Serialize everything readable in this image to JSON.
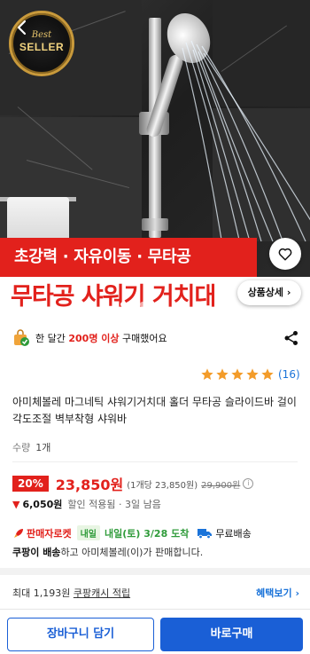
{
  "hero": {
    "badge_top": "Best",
    "badge_main": "SELLER",
    "headline_top": "초강력 · 자유이동 · 무타공",
    "headline_main": "무타공 샤워기 거치대",
    "detail_button": "상품상세",
    "slide_count": 5,
    "active_slide": 1,
    "colors": {
      "band_red": "#e2211c"
    }
  },
  "purchase_stats": {
    "prefix": "한 달간",
    "count": "200명 이상",
    "suffix": "구매했어요"
  },
  "rating": {
    "stars": 5,
    "count": "(16)"
  },
  "product": {
    "title": "아미체볼레 마그네틱 샤워기거치대 홀더 무타공 슬라이드바 걸이 각도조절 벽부착형 샤워바",
    "quantity_label": "수량",
    "quantity_value": "1개"
  },
  "price": {
    "discount": "20%",
    "sale": "23,850원",
    "unit_price": "(1개당 23,850원)",
    "original": "29,900원",
    "info_glyph": "i",
    "savings_amount": "6,050원",
    "savings_note": "할인 적용됨 · 3일 남음",
    "colors": {
      "sale": "#e2211c",
      "link": "#1a73d9",
      "primary": "#1a5fd6"
    }
  },
  "delivery": {
    "rocket_label": "판매자로켓",
    "tomorrow_tag": "내일",
    "arrival": "내일(토) 3/28 도착",
    "free_shipping": "무료배송",
    "seller_bold": "쿠팡이 배송",
    "seller_rest": "하고 아미체볼레(이)가 판매합니다."
  },
  "cash": {
    "prefix": "최대 1,193원",
    "link": "쿠팡캐시 적립",
    "benefits": "혜택보기 ›"
  },
  "actions": {
    "cart": "장바구니 담기",
    "buy": "바로구매"
  },
  "icons": [
    "back-icon",
    "heart-icon",
    "shopping-bag-icon",
    "share-icon",
    "star-icon",
    "rocket-icon",
    "truck-icon",
    "info-icon",
    "arrow-down-icon"
  ]
}
